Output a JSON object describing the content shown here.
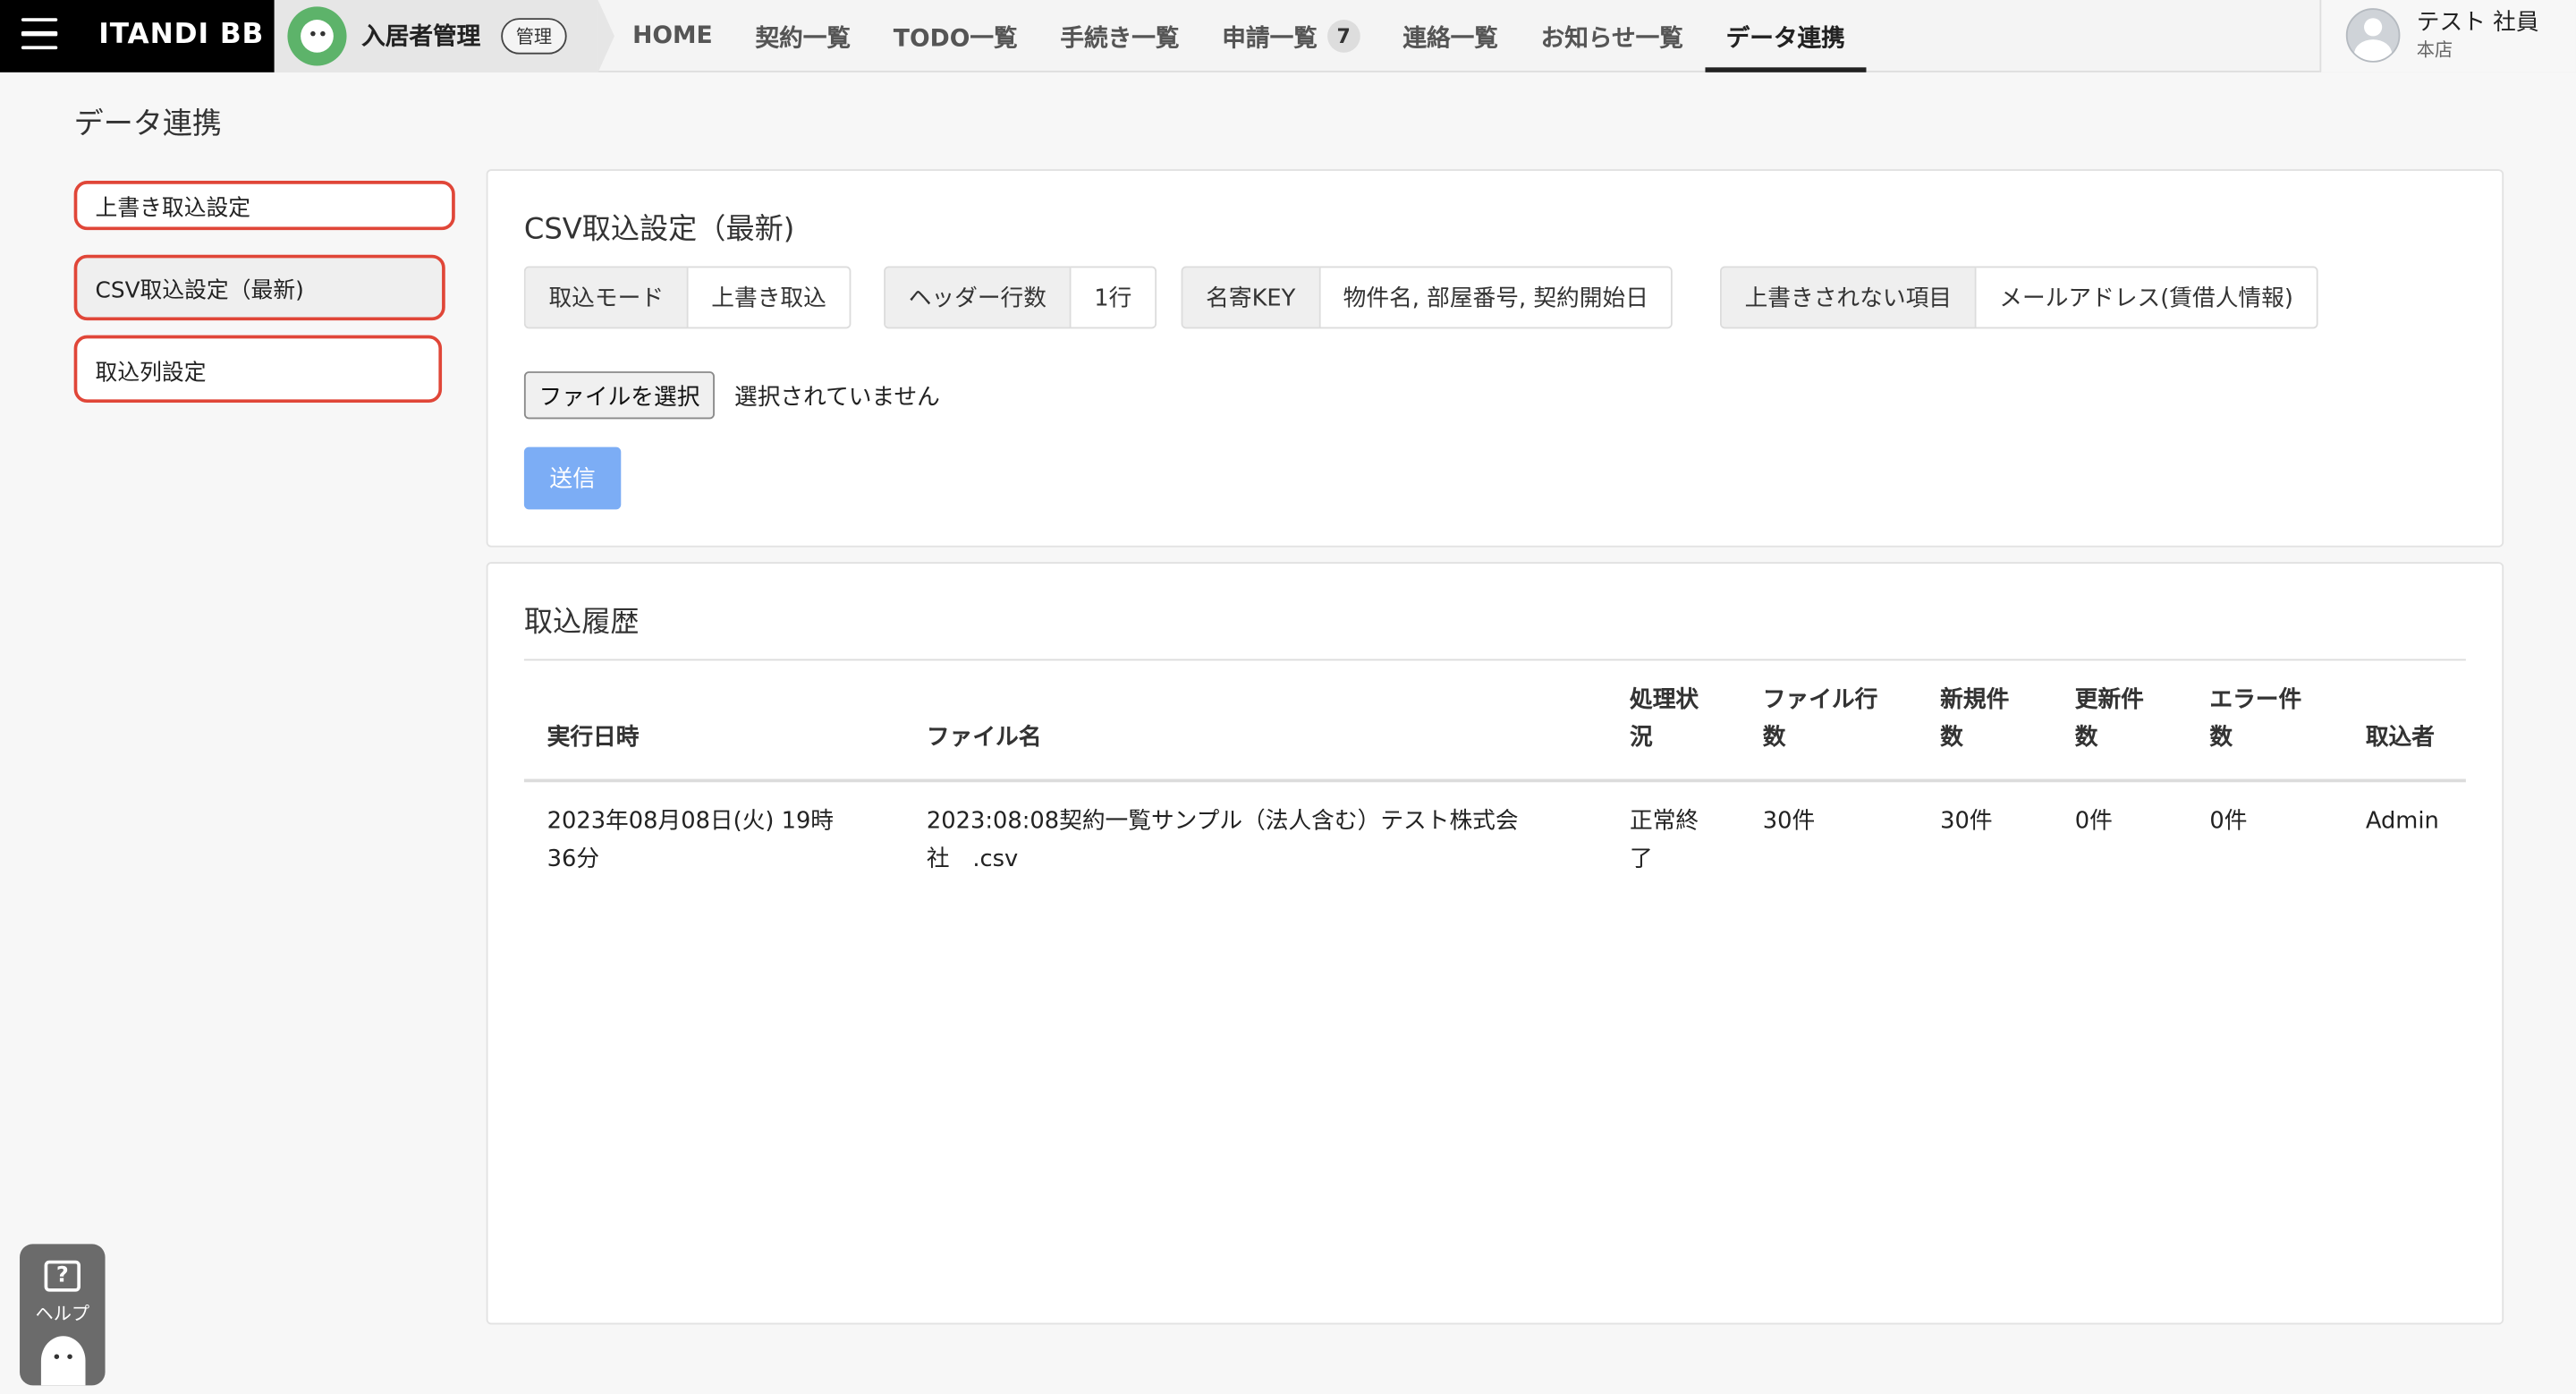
{
  "header": {
    "brand": "ITANDI BB",
    "product_name": "入居者管理",
    "product_badge": "管理",
    "nav": [
      {
        "label": "HOME"
      },
      {
        "label": "契約一覧"
      },
      {
        "label": "TODO一覧"
      },
      {
        "label": "手続き一覧"
      },
      {
        "label": "申請一覧",
        "count": "7"
      },
      {
        "label": "連絡一覧"
      },
      {
        "label": "お知らせ一覧"
      },
      {
        "label": "データ連携",
        "active": true
      }
    ],
    "user_name": "テスト 社員",
    "user_store": "本店"
  },
  "page_title": "データ連携",
  "side_menu": [
    {
      "label": "上書き取込設定"
    },
    {
      "label": "CSV取込設定（最新)",
      "current": true
    },
    {
      "label": "取込列設定"
    }
  ],
  "csv_settings": {
    "title": "CSV取込設定（最新)",
    "items": [
      {
        "label": "取込モード",
        "value": "上書き取込"
      },
      {
        "label": "ヘッダー行数",
        "value": "1行"
      },
      {
        "label": "名寄KEY",
        "value": "物件名, 部屋番号, 契約開始日"
      },
      {
        "label": "上書きされない項目",
        "value": "メールアドレス(賃借人情報)"
      }
    ],
    "file_button": "ファイルを選択",
    "file_status": "選択されていません",
    "submit": "送信"
  },
  "history": {
    "title": "取込履歴",
    "columns": {
      "datetime": "実行日時",
      "filename": "ファイル名",
      "status_1": "処理状",
      "status_2": "況",
      "rows_1": "ファイル行",
      "rows_2": "数",
      "new_1": "新規件",
      "new_2": "数",
      "updated_1": "更新件",
      "updated_2": "数",
      "error_1": "エラー件",
      "error_2": "数",
      "importer": "取込者"
    },
    "row": {
      "datetime_1": "2023年08月08日(火) 19時",
      "datetime_2": "36分",
      "filename_1": "2023:08:08契約一覧サンプル（法人含む）テスト株式会",
      "filename_2": "社　.csv",
      "status_1": "正常終",
      "status_2": "了",
      "rows": "30件",
      "new": "30件",
      "updated": "0件",
      "error": "0件",
      "importer": "Admin"
    }
  },
  "help_label": "ヘルプ",
  "colors": {
    "highlight": "#e04638",
    "submit": "#7cadf5",
    "brand_bg": "#000000"
  }
}
